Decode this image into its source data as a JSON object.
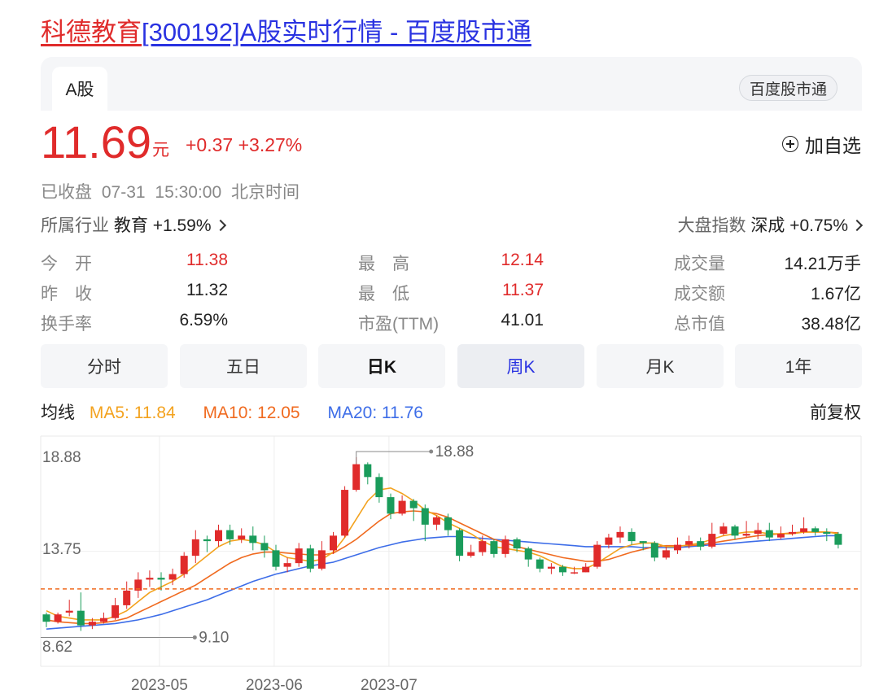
{
  "title": {
    "stock_name": "科德教育",
    "code_suffix": "[300192]A股实时行情 - 百度股市通"
  },
  "tabs": {
    "active": "A股",
    "brand": "百度股市通"
  },
  "quote": {
    "price": "11.69",
    "unit": "元",
    "change": "+0.37",
    "change_pct": "+3.27%",
    "add_watch": "加自选",
    "status": "已收盘",
    "time": "07-31 15:30:00",
    "timezone": "北京时间"
  },
  "industry": {
    "label": "所属行业",
    "name": "教育",
    "change": "+1.59%"
  },
  "market": {
    "label": "大盘指数",
    "name": "深成",
    "change": "+0.75%"
  },
  "stats": [
    {
      "label": "今　开",
      "value": "11.38"
    },
    {
      "label": "最　高",
      "value": "12.14"
    },
    {
      "label": "成交量",
      "value": "14.21万手"
    },
    {
      "label": "昨　收",
      "value": "11.32"
    },
    {
      "label": "最　低",
      "value": "11.37"
    },
    {
      "label": "成交额",
      "value": "1.67亿"
    },
    {
      "label": "换手率",
      "value": "6.59%"
    },
    {
      "label": "市盈(TTM)",
      "value": "41.01"
    },
    {
      "label": "总市值",
      "value": "38.48亿"
    }
  ],
  "periods": [
    "分时",
    "五日",
    "日K",
    "周K",
    "月K",
    "1年"
  ],
  "ma": {
    "label": "均线",
    "ma5": "MA5: 11.84",
    "ma10": "MA10: 12.05",
    "ma20": "MA20: 11.76",
    "adjust": "前复权"
  },
  "colors": {
    "up": "#e02b2b",
    "down": "#1a9c5b",
    "ma5": "#f3a21e",
    "ma10": "#f06a1f",
    "ma20": "#3d6de8",
    "brand_blue": "#2932e1"
  },
  "chart_data": {
    "type": "candlestick",
    "y_ticks": [
      "18.88",
      "13.75",
      "8.62"
    ],
    "ylim": [
      8.62,
      18.88
    ],
    "x_ticks": [
      "2023-05",
      "2023-06",
      "2023-07"
    ],
    "x_tick_index": [
      9,
      19,
      29
    ],
    "annotations": {
      "high": "18.88",
      "low": "9.10"
    },
    "last_close": 11.69,
    "candles": [
      [
        10.3,
        9.9,
        10.4,
        9.6
      ],
      [
        9.9,
        10.3,
        10.4,
        9.8
      ],
      [
        10.4,
        10.5,
        11.1,
        10.2
      ],
      [
        10.5,
        9.7,
        11.5,
        9.4
      ],
      [
        9.7,
        9.9,
        10.1,
        9.5
      ],
      [
        9.9,
        10.1,
        10.4,
        9.8
      ],
      [
        10.1,
        10.8,
        11.2,
        10.0
      ],
      [
        10.8,
        11.6,
        12.1,
        10.6
      ],
      [
        11.6,
        12.2,
        12.6,
        11.2
      ],
      [
        12.2,
        12.3,
        12.7,
        11.8
      ],
      [
        12.3,
        12.2,
        12.6,
        11.6
      ],
      [
        12.2,
        12.5,
        12.8,
        11.9
      ],
      [
        12.5,
        13.5,
        13.7,
        12.3
      ],
      [
        13.5,
        14.4,
        14.9,
        13.1
      ],
      [
        14.4,
        14.3,
        14.6,
        13.7
      ],
      [
        14.3,
        14.9,
        15.2,
        14.0
      ],
      [
        14.9,
        14.4,
        15.2,
        14.1
      ],
      [
        14.4,
        14.6,
        15.0,
        14.2
      ],
      [
        14.6,
        14.2,
        15.1,
        13.8
      ],
      [
        14.2,
        13.8,
        14.6,
        13.4
      ],
      [
        13.8,
        12.9,
        14.1,
        12.7
      ],
      [
        12.9,
        13.1,
        13.4,
        12.6
      ],
      [
        13.1,
        13.9,
        14.2,
        12.9
      ],
      [
        13.9,
        12.8,
        14.1,
        12.6
      ],
      [
        12.8,
        13.8,
        14.3,
        12.7
      ],
      [
        13.8,
        14.6,
        14.8,
        13.6
      ],
      [
        14.6,
        17.1,
        17.3,
        14.5
      ],
      [
        17.1,
        18.5,
        18.88,
        17.0
      ],
      [
        18.5,
        17.8,
        18.6,
        17.4
      ],
      [
        17.8,
        16.7,
        18.0,
        16.4
      ],
      [
        16.7,
        15.8,
        16.9,
        15.5
      ],
      [
        15.8,
        16.5,
        16.8,
        15.7
      ],
      [
        16.5,
        16.1,
        16.6,
        15.4
      ],
      [
        16.1,
        15.2,
        16.3,
        14.3
      ],
      [
        15.2,
        15.6,
        15.7,
        14.9
      ],
      [
        15.6,
        14.9,
        15.8,
        14.6
      ],
      [
        14.9,
        13.5,
        15.0,
        13.2
      ],
      [
        13.5,
        13.7,
        14.1,
        13.4
      ],
      [
        13.7,
        14.3,
        14.6,
        13.5
      ],
      [
        14.3,
        13.6,
        14.4,
        13.4
      ],
      [
        13.6,
        14.4,
        14.6,
        13.4
      ],
      [
        14.4,
        13.9,
        14.5,
        13.7
      ],
      [
        13.9,
        13.3,
        14.0,
        12.9
      ],
      [
        13.3,
        12.8,
        13.4,
        12.6
      ],
      [
        12.8,
        12.9,
        13.1,
        12.5
      ],
      [
        12.9,
        12.6,
        13.0,
        12.4
      ],
      [
        12.6,
        12.6,
        12.9,
        12.5
      ],
      [
        12.6,
        12.9,
        13.1,
        12.6
      ],
      [
        12.9,
        14.1,
        14.3,
        12.8
      ],
      [
        14.1,
        14.5,
        14.7,
        13.9
      ],
      [
        14.5,
        14.8,
        15.1,
        14.2
      ],
      [
        14.8,
        14.3,
        15.0,
        14.1
      ],
      [
        14.3,
        14.2,
        14.3,
        13.8
      ],
      [
        14.2,
        13.4,
        14.3,
        13.2
      ],
      [
        13.4,
        13.8,
        14.0,
        13.3
      ],
      [
        13.8,
        14.1,
        14.5,
        13.6
      ],
      [
        14.1,
        14.3,
        14.6,
        13.9
      ],
      [
        14.3,
        14.0,
        14.5,
        13.8
      ],
      [
        14.0,
        14.7,
        15.3,
        13.9
      ],
      [
        14.7,
        15.1,
        15.3,
        14.6
      ],
      [
        15.1,
        14.6,
        15.2,
        14.4
      ],
      [
        14.6,
        14.7,
        15.4,
        14.5
      ],
      [
        14.7,
        14.9,
        15.3,
        14.4
      ],
      [
        14.9,
        14.5,
        15.3,
        14.3
      ],
      [
        14.5,
        14.7,
        15.1,
        14.4
      ],
      [
        14.7,
        14.8,
        15.2,
        14.6
      ],
      [
        14.8,
        15.0,
        15.6,
        14.7
      ],
      [
        15.0,
        14.8,
        15.1,
        14.6
      ],
      [
        14.8,
        14.7,
        15.0,
        14.3
      ],
      [
        14.7,
        14.1,
        14.8,
        13.9
      ]
    ],
    "ma5": [
      10.5,
      10.2,
      10.1,
      10.0,
      10.0,
      10.0,
      10.2,
      10.5,
      11.0,
      11.5,
      11.8,
      12.1,
      12.5,
      13.0,
      13.5,
      14.0,
      14.3,
      14.4,
      14.3,
      14.1,
      13.7,
      13.4,
      13.3,
      13.2,
      13.3,
      13.7,
      14.5,
      15.5,
      16.5,
      17.1,
      17.2,
      16.9,
      16.5,
      16.0,
      15.7,
      15.3,
      15.0,
      14.7,
      14.3,
      14.0,
      13.9,
      13.8,
      13.7,
      13.5,
      13.2,
      12.9,
      12.8,
      12.8,
      13.1,
      13.5,
      13.9,
      14.1,
      14.2,
      14.2,
      14.0,
      14.0,
      14.1,
      14.2,
      14.4,
      14.6,
      14.7,
      14.8,
      14.8,
      14.7,
      14.7,
      14.7,
      14.8,
      14.8,
      14.8,
      14.7
    ],
    "ma10": [
      10.0,
      9.9,
      9.85,
      9.8,
      9.8,
      9.85,
      9.95,
      10.1,
      10.4,
      10.7,
      11.0,
      11.3,
      11.6,
      11.9,
      12.3,
      12.7,
      13.1,
      13.4,
      13.6,
      13.7,
      13.7,
      13.65,
      13.6,
      13.55,
      13.55,
      13.65,
      14.0,
      14.4,
      14.9,
      15.4,
      15.8,
      15.9,
      15.95,
      15.9,
      15.8,
      15.6,
      15.3,
      15.0,
      14.7,
      14.4,
      14.2,
      14.0,
      13.85,
      13.7,
      13.55,
      13.4,
      13.3,
      13.2,
      13.2,
      13.3,
      13.5,
      13.7,
      13.85,
      14.0,
      14.05,
      14.05,
      14.05,
      14.1,
      14.2,
      14.3,
      14.4,
      14.5,
      14.6,
      14.65,
      14.7,
      14.75,
      14.8,
      14.8,
      14.8,
      14.75
    ],
    "ma20": [
      9.5,
      9.55,
      9.6,
      9.65,
      9.7,
      9.75,
      9.8,
      9.9,
      10.0,
      10.15,
      10.3,
      10.5,
      10.7,
      10.9,
      11.1,
      11.35,
      11.6,
      11.85,
      12.1,
      12.3,
      12.5,
      12.65,
      12.8,
      12.95,
      13.05,
      13.15,
      13.35,
      13.55,
      13.75,
      13.95,
      14.1,
      14.25,
      14.35,
      14.45,
      14.5,
      14.55,
      14.55,
      14.5,
      14.45,
      14.4,
      14.35,
      14.3,
      14.25,
      14.2,
      14.15,
      14.1,
      14.05,
      14.0,
      14.0,
      14.0,
      14.0,
      14.0,
      13.95,
      13.95,
      13.95,
      13.95,
      14.0,
      14.05,
      14.1,
      14.15,
      14.2,
      14.25,
      14.3,
      14.35,
      14.4,
      14.45,
      14.5,
      14.55,
      14.6,
      14.6
    ]
  }
}
